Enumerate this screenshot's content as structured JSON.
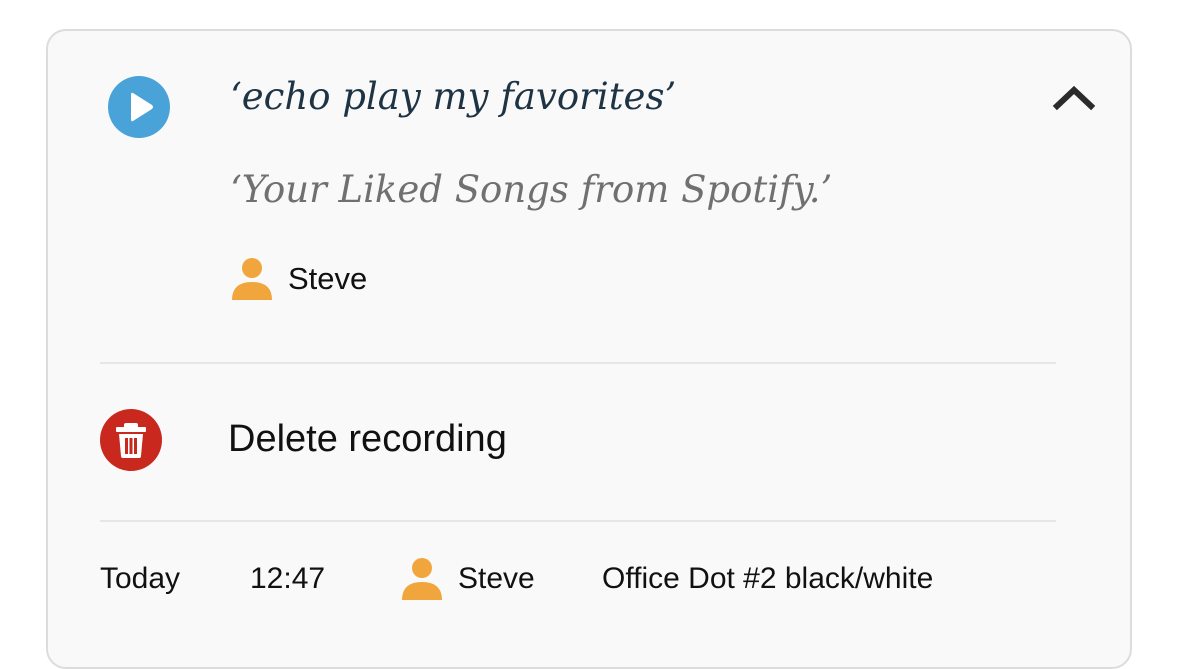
{
  "recording": {
    "utterance": "‘echo play my favorites’",
    "response": "‘Your Liked Songs from Spotify.’",
    "speaker": "Steve"
  },
  "actions": {
    "delete_label": "Delete recording"
  },
  "meta": {
    "date": "Today",
    "time": "12:47",
    "speaker": "Steve",
    "device": "Office Dot #2 black/white"
  },
  "icons": {
    "play": "play-icon",
    "collapse": "chevron-up-icon",
    "person": "person-icon",
    "delete": "trash-icon"
  },
  "colors": {
    "play_button": "#4aa3d8",
    "delete_button": "#c8281e",
    "person_icon": "#f0a63c",
    "utterance_text": "#1e3445",
    "response_text": "#707070"
  }
}
